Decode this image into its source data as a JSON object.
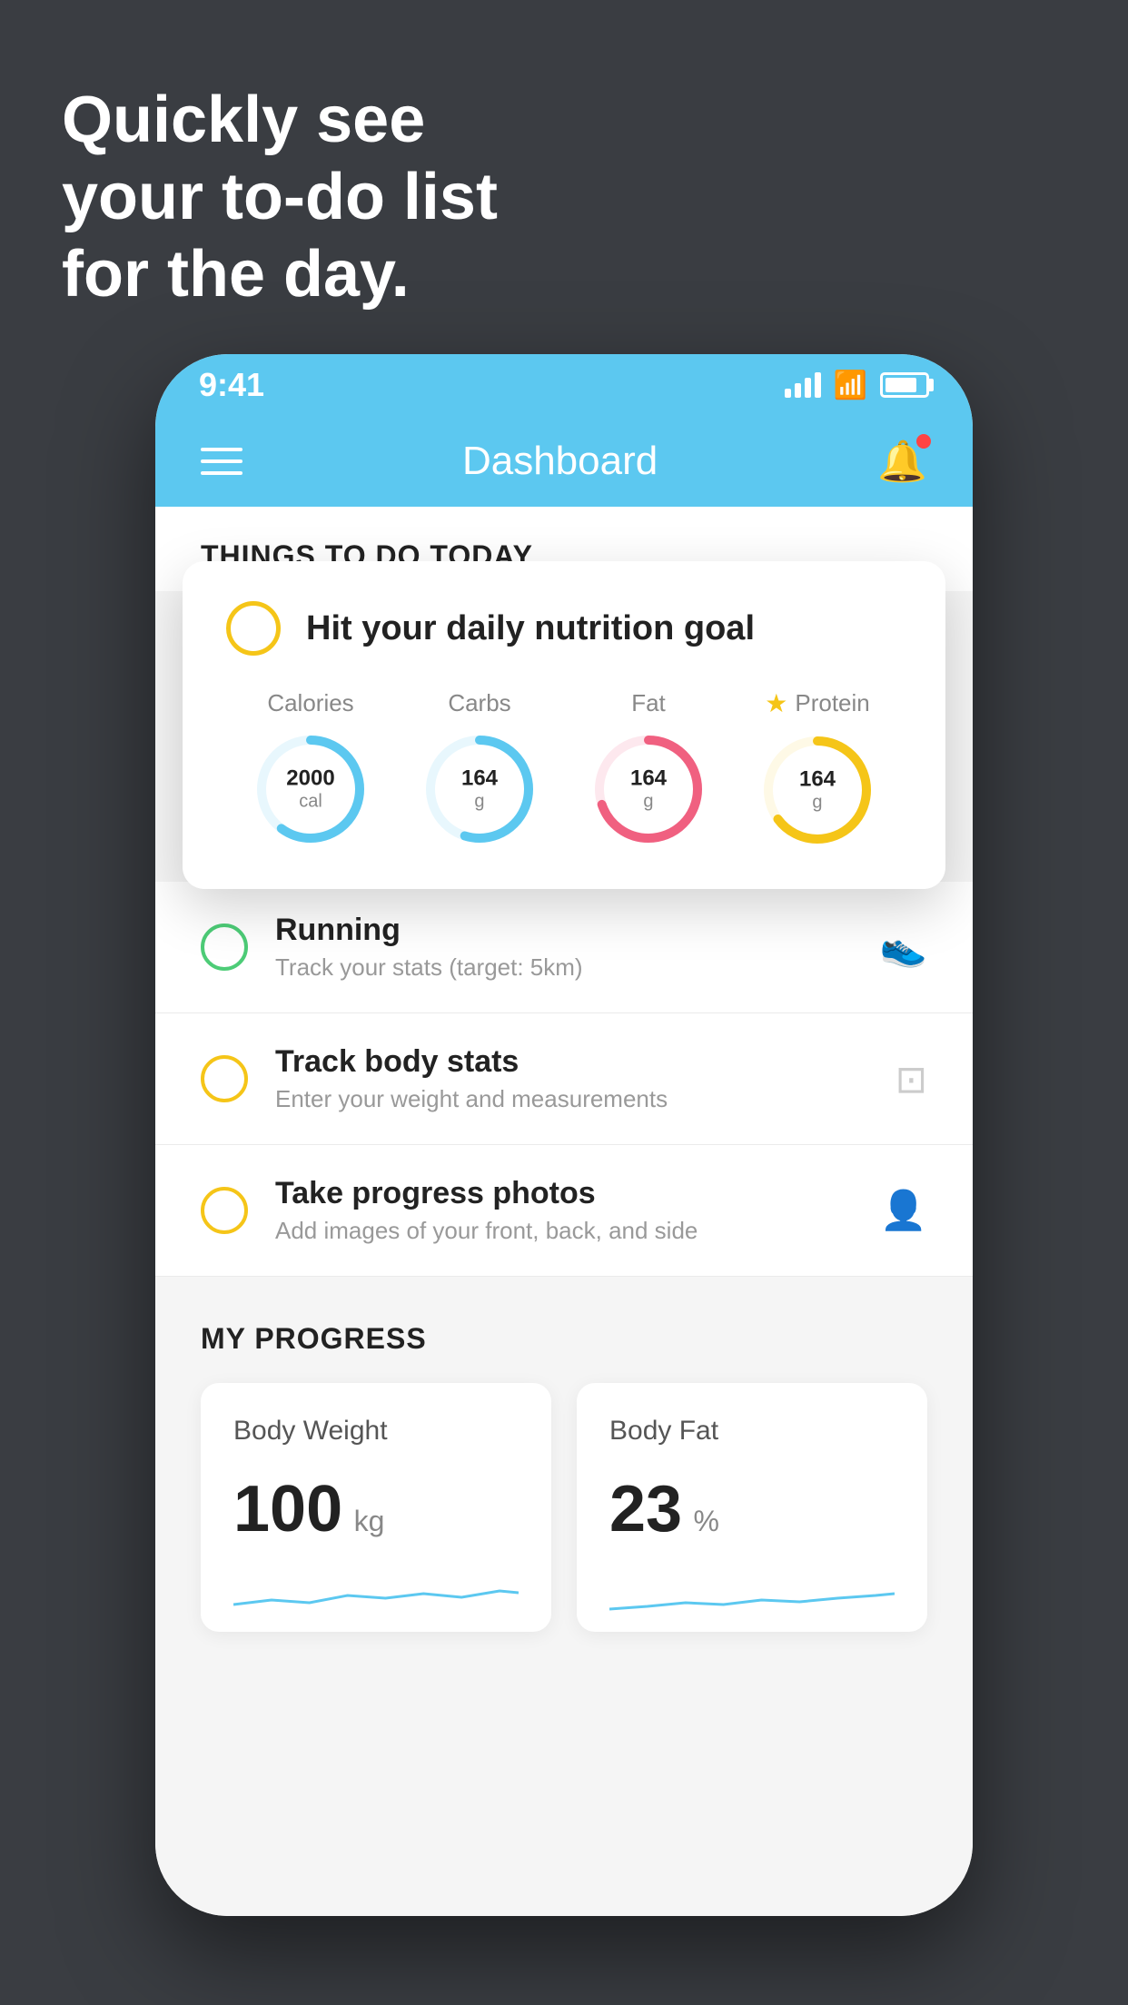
{
  "background_color": "#3a3d42",
  "headline": {
    "line1": "Quickly see",
    "line2": "your to-do list",
    "line3": "for the day.",
    "full": "Quickly see\nyour to-do list\nfor the day."
  },
  "status_bar": {
    "time": "9:41",
    "signal": "●●●●",
    "wifi": "wifi",
    "battery": "battery"
  },
  "header": {
    "title": "Dashboard",
    "menu_label": "menu",
    "notification_label": "notifications"
  },
  "things_to_do": {
    "section_title": "THINGS TO DO TODAY"
  },
  "nutrition_card": {
    "circle_color": "#f5c518",
    "title": "Hit your daily nutrition goal",
    "stats": [
      {
        "label": "Calories",
        "value": "2000",
        "unit": "cal",
        "color": "#5cc8f0",
        "percent": 60
      },
      {
        "label": "Carbs",
        "value": "164",
        "unit": "g",
        "color": "#5cc8f0",
        "percent": 55
      },
      {
        "label": "Fat",
        "value": "164",
        "unit": "g",
        "color": "#f06080",
        "percent": 70
      },
      {
        "label": "Protein",
        "value": "164",
        "unit": "g",
        "color": "#f5c518",
        "percent": 65,
        "starred": true
      }
    ]
  },
  "todo_items": [
    {
      "id": 1,
      "circle_color": "green",
      "title": "Running",
      "subtitle": "Track your stats (target: 5km)",
      "icon": "shoe"
    },
    {
      "id": 2,
      "circle_color": "yellow",
      "title": "Track body stats",
      "subtitle": "Enter your weight and measurements",
      "icon": "scale"
    },
    {
      "id": 3,
      "circle_color": "yellow",
      "title": "Take progress photos",
      "subtitle": "Add images of your front, back, and side",
      "icon": "person"
    }
  ],
  "progress": {
    "section_title": "MY PROGRESS",
    "cards": [
      {
        "title": "Body Weight",
        "value": "100",
        "unit": "kg"
      },
      {
        "title": "Body Fat",
        "value": "23",
        "unit": "%"
      }
    ]
  }
}
